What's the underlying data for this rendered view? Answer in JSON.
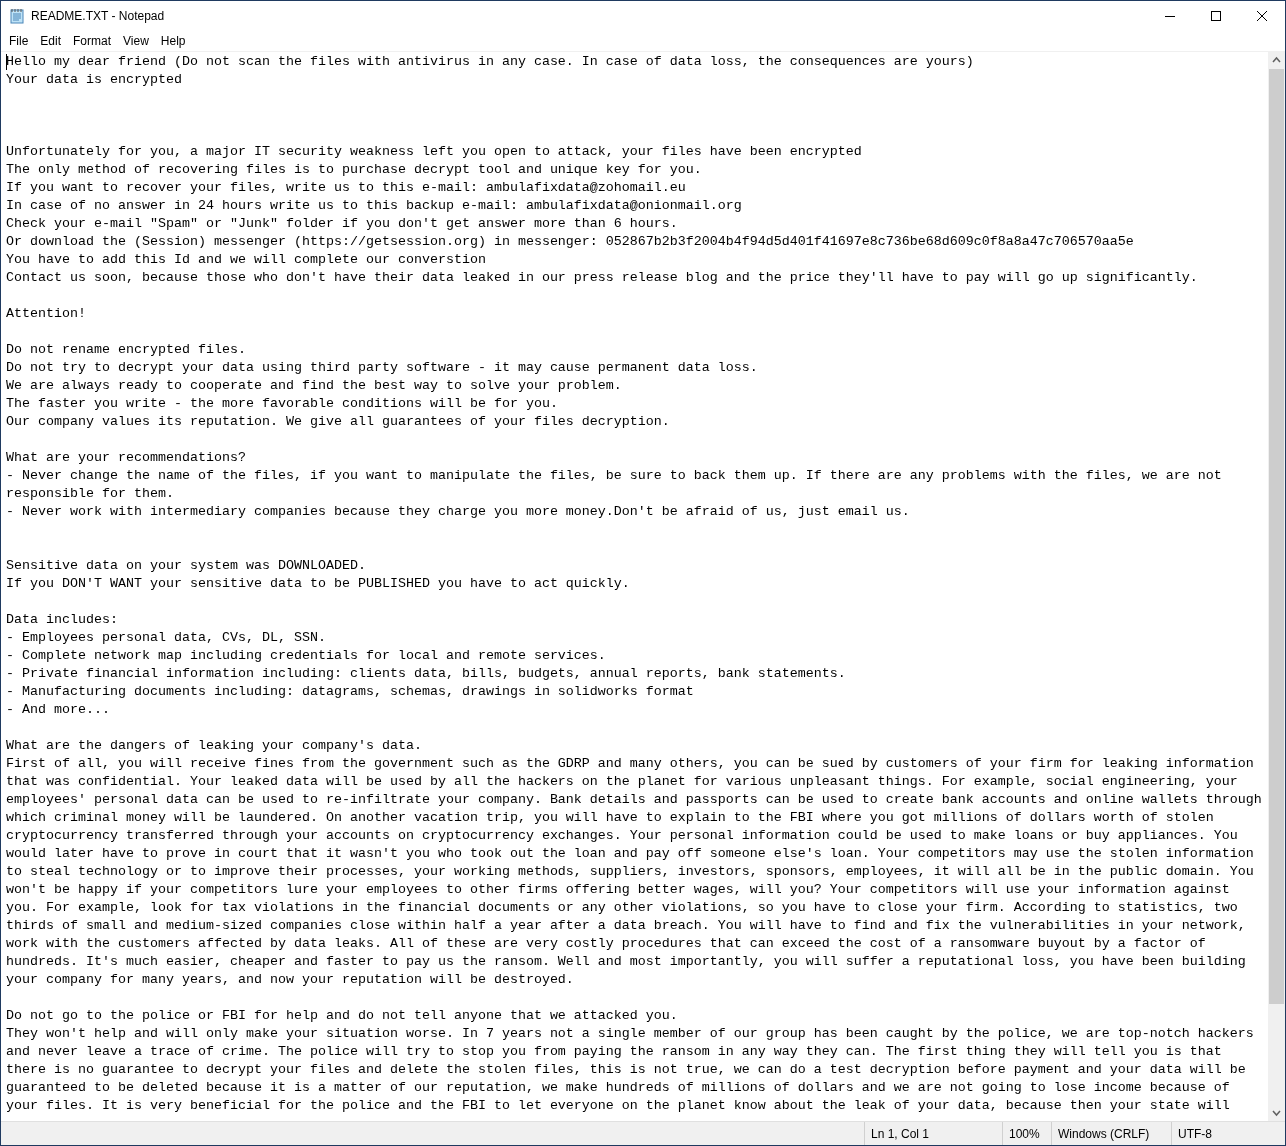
{
  "window": {
    "title": "README.TXT - Notepad"
  },
  "menu": [
    "File",
    "Edit",
    "Format",
    "View",
    "Help"
  ],
  "document": {
    "text": "Hello my dear friend (Do not scan the files with antivirus in any case. In case of data loss, the consequences are yours)\nYour data is encrypted\n\n\n\nUnfortunately for you, a major IT security weakness left you open to attack, your files have been encrypted\nThe only method of recovering files is to purchase decrypt tool and unique key for you.\nIf you want to recover your files, write us to this e-mail: ambulafixdata@zohomail.eu\nIn case of no answer in 24 hours write us to this backup e-mail: ambulafixdata@onionmail.org\nCheck your e-mail \"Spam\" or \"Junk\" folder if you don't get answer more than 6 hours.\nOr download the (Session) messenger (https://getsession.org) in messenger: 052867b2b3f2004b4f94d5d401f41697e8c736be68d609c0f8a8a47c706570aa5e\nYou have to add this Id and we will complete our converstion\nContact us soon, because those who don't have their data leaked in our press release blog and the price they'll have to pay will go up significantly.\n\nAttention!\n\nDo not rename encrypted files.\nDo not try to decrypt your data using third party software - it may cause permanent data loss.\nWe are always ready to cooperate and find the best way to solve your problem.\nThe faster you write - the more favorable conditions will be for you.\nOur company values its reputation. We give all guarantees of your files decryption.\n\nWhat are your recommendations?\n- Never change the name of the files, if you want to manipulate the files, be sure to back them up. If there are any problems with the files, we are not\nresponsible for them.\n- Never work with intermediary companies because they charge you more money.Don't be afraid of us, just email us.\n\n\nSensitive data on your system was DOWNLOADED.\nIf you DON'T WANT your sensitive data to be PUBLISHED you have to act quickly.\n\nData includes:\n- Employees personal data, CVs, DL, SSN.\n- Complete network map including credentials for local and remote services.\n- Private financial information including: clients data, bills, budgets, annual reports, bank statements.\n- Manufacturing documents including: datagrams, schemas, drawings in solidworks format\n- And more...\n\nWhat are the dangers of leaking your company's data.\nFirst of all, you will receive fines from the government such as the GDRP and many others, you can be sued by customers of your firm for leaking information\nthat was confidential. Your leaked data will be used by all the hackers on the planet for various unpleasant things. For example, social engineering, your\nemployees' personal data can be used to re-infiltrate your company. Bank details and passports can be used to create bank accounts and online wallets through\nwhich criminal money will be laundered. On another vacation trip, you will have to explain to the FBI where you got millions of dollars worth of stolen\ncryptocurrency transferred through your accounts on cryptocurrency exchanges. Your personal information could be used to make loans or buy appliances. You\nwould later have to prove in court that it wasn't you who took out the loan and pay off someone else's loan. Your competitors may use the stolen information\nto steal technology or to improve their processes, your working methods, suppliers, investors, sponsors, employees, it will all be in the public domain. You\nwon't be happy if your competitors lure your employees to other firms offering better wages, will you? Your competitors will use your information against\nyou. For example, look for tax violations in the financial documents or any other violations, so you have to close your firm. According to statistics, two\nthirds of small and medium-sized companies close within half a year after a data breach. You will have to find and fix the vulnerabilities in your network,\nwork with the customers affected by data leaks. All of these are very costly procedures that can exceed the cost of a ransomware buyout by a factor of\nhundreds. It's much easier, cheaper and faster to pay us the ransom. Well and most importantly, you will suffer a reputational loss, you have been building\nyour company for many years, and now your reputation will be destroyed.\n\nDo not go to the police or FBI for help and do not tell anyone that we attacked you.\nThey won't help and will only make your situation worse. In 7 years not a single member of our group has been caught by the police, we are top-notch hackers\nand never leave a trace of crime. The police will try to stop you from paying the ransom in any way they can. The first thing they will tell you is that\nthere is no guarantee to decrypt your files and delete the stolen files, this is not true, we can do a test decryption before payment and your data will be\nguaranteed to be deleted because it is a matter of our reputation, we make hundreds of millions of dollars and we are not going to lose income because of\nyour files. It is very beneficial for the police and the FBI to let everyone on the planet know about the leak of your data, because then your state will"
  },
  "status_bar": {
    "position": "Ln 1, Col 1",
    "zoom": "100%",
    "line_endings": "Windows (CRLF)",
    "encoding": "UTF-8"
  }
}
